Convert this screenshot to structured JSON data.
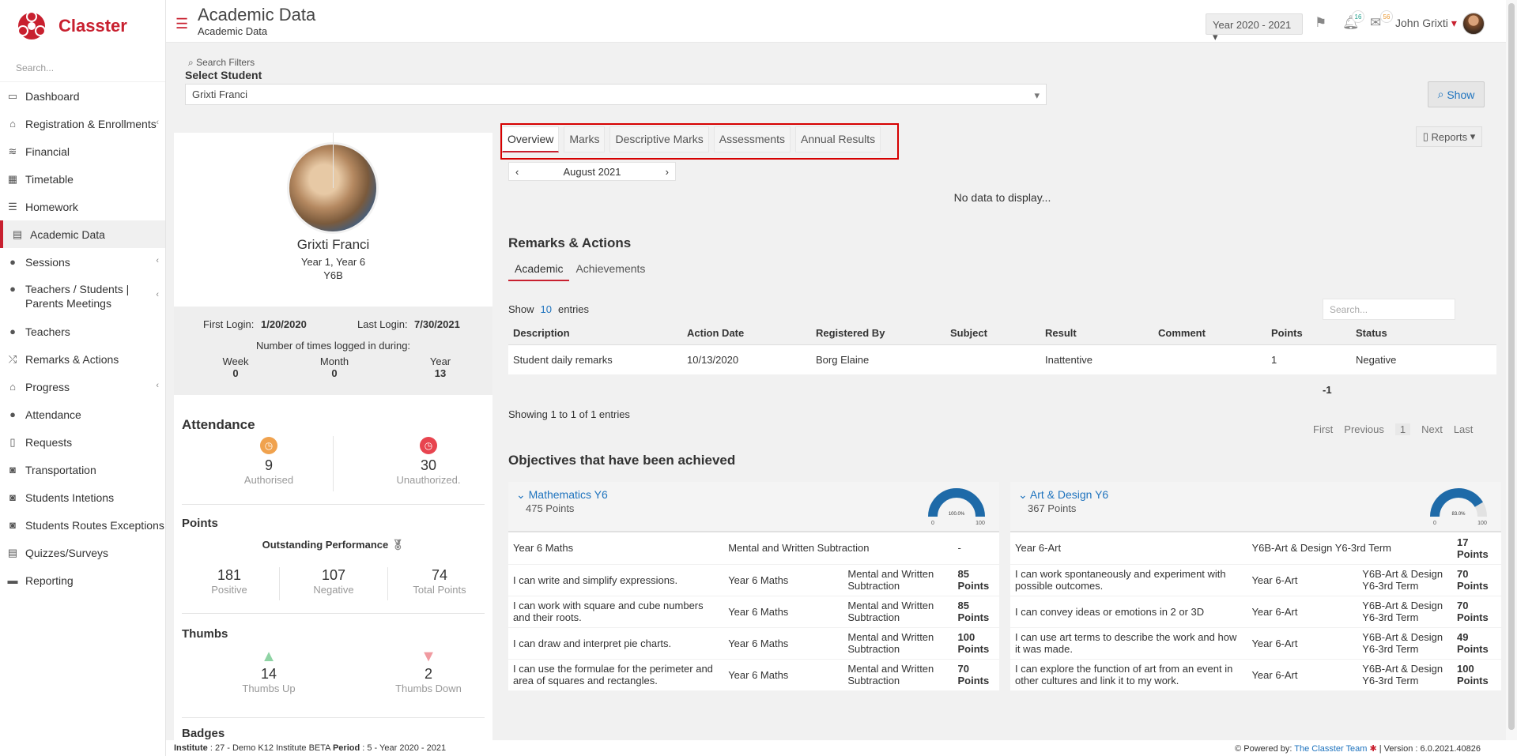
{
  "brand": {
    "name": "Classter"
  },
  "sidebar": {
    "search_placeholder": "Search...",
    "items": [
      {
        "label": "Dashboard",
        "icon": "laptop-icon"
      },
      {
        "label": "Registration & Enrollments",
        "icon": "bank-icon"
      },
      {
        "label": "Financial",
        "icon": "coins-icon"
      },
      {
        "label": "Timetable",
        "icon": "calendar-icon"
      },
      {
        "label": "Homework",
        "icon": "list-icon"
      },
      {
        "label": "Academic Data",
        "icon": "report-icon"
      },
      {
        "label": "Sessions",
        "icon": "users-icon"
      },
      {
        "label": "Teachers / Students | Parents Meetings",
        "icon": "meeting-icon"
      },
      {
        "label": "Teachers",
        "icon": "teachers-icon"
      },
      {
        "label": "Remarks & Actions",
        "icon": "remarks-icon"
      },
      {
        "label": "Progress",
        "icon": "graduation-cap-icon"
      },
      {
        "label": "Attendance",
        "icon": "user-x-icon"
      },
      {
        "label": "Requests",
        "icon": "document-icon"
      },
      {
        "label": "Transportation",
        "icon": "bus-icon"
      },
      {
        "label": "Students Intetions",
        "icon": "bus-icon"
      },
      {
        "label": "Students Routes Exceptions",
        "icon": "bus-icon"
      },
      {
        "label": "Quizzes/Surveys",
        "icon": "quiz-icon"
      },
      {
        "label": "Reporting",
        "icon": "printer-icon"
      }
    ]
  },
  "header": {
    "title": "Academic Data",
    "subtitle": "Academic Data",
    "year": "Year 2020 - 2021",
    "notifications": "16",
    "messages": "56",
    "user": "John Grixti"
  },
  "filters": {
    "label": "Search Filters",
    "select_student_label": "Select Student",
    "student": "Grixti Franci",
    "show_label": "Show"
  },
  "profile": {
    "name": "Grixti Franci",
    "year": "Year 1, Year 6",
    "class": "Y6B",
    "first_login_label": "First Login:",
    "first_login": "1/20/2020",
    "last_login_label": "Last Login:",
    "last_login": "7/30/2021",
    "times_label": "Number of times logged in during:",
    "week_label": "Week",
    "week": "0",
    "month_label": "Month",
    "month": "0",
    "year_label": "Year",
    "year_val": "13"
  },
  "attendance": {
    "title": "Attendance",
    "authorised": "9",
    "authorised_label": "Authorised",
    "unauthorized": "30",
    "unauthorized_label": "Unauthorized."
  },
  "points": {
    "title": "Points",
    "performance": "Outstanding Performance",
    "positive": "181",
    "positive_label": "Positive",
    "negative": "107",
    "negative_label": "Negative",
    "total": "74",
    "total_label": "Total Points"
  },
  "thumbs": {
    "title": "Thumbs",
    "up": "14",
    "up_label": "Thumbs Up",
    "down": "2",
    "down_label": "Thumbs Down"
  },
  "badges": {
    "title": "Badges"
  },
  "tabs": [
    "Overview",
    "Marks",
    "Descriptive Marks",
    "Assessments",
    "Annual Results"
  ],
  "reports_label": "Reports",
  "month": "August 2021",
  "no_data": "No data to display...",
  "remarks": {
    "title": "Remarks & Actions",
    "sub_tabs": [
      "Academic",
      "Achievements"
    ],
    "show": "Show",
    "entries_count": "10",
    "entries": "entries",
    "search_placeholder": "Search...",
    "columns": [
      "Description",
      "Action Date",
      "Registered By",
      "Subject",
      "Result",
      "Comment",
      "Points",
      "Status"
    ],
    "rows": [
      [
        "Student daily remarks",
        "10/13/2020",
        "Borg Elaine",
        "",
        "Inattentive",
        "",
        "1",
        "Negative"
      ]
    ],
    "total": "-1",
    "showing": "Showing 1 to 1 of 1 entries",
    "pager": [
      "First",
      "Previous",
      "1",
      "Next",
      "Last"
    ]
  },
  "objectives": {
    "title": "Objectives that have been achieved",
    "cards": [
      {
        "subject": "Mathematics Y6",
        "points": "475 Points",
        "gauge_pct": 100.0,
        "gauge_label": "100.0%",
        "gauge_min": "0",
        "gauge_max": "100",
        "rows": [
          [
            "Year 6 Maths",
            "Mental and Written Subtraction",
            "-",
            ""
          ],
          [
            "I can write and simplify expressions.",
            "Year 6 Maths",
            "Mental and Written Subtraction",
            "85 Points"
          ],
          [
            "I can work with square and cube numbers and their roots.",
            "Year 6 Maths",
            "Mental and Written Subtraction",
            "85 Points"
          ],
          [
            "I can draw and interpret pie charts.",
            "Year 6 Maths",
            "Mental and Written Subtraction",
            "100 Points"
          ],
          [
            "I can use the formulae for the perimeter and area of squares and rectangles.",
            "Year 6 Maths",
            "Mental and Written Subtraction",
            "70 Points"
          ]
        ]
      },
      {
        "subject": "Art & Design Y6",
        "points": "367 Points",
        "gauge_pct": 83.0,
        "gauge_label": "83.0%",
        "gauge_min": "0",
        "gauge_max": "100",
        "rows": [
          [
            "Year 6-Art",
            "Y6B-Art & Design Y6-3rd Term",
            "17 Points",
            ""
          ],
          [
            "I can work spontaneously and experiment with possible outcomes.",
            "Year 6-Art",
            "Y6B-Art & Design Y6-3rd Term",
            "70 Points"
          ],
          [
            "I can convey ideas or emotions in 2 or 3D",
            "Year 6-Art",
            "Y6B-Art & Design Y6-3rd Term",
            "70 Points"
          ],
          [
            "I can use art terms to describe the work and how it was made.",
            "Year 6-Art",
            "Y6B-Art & Design Y6-3rd Term",
            "49 Points"
          ],
          [
            "I can explore the function of art from an event in other cultures and link it to my work.",
            "Year 6-Art",
            "Y6B-Art & Design Y6-3rd Term",
            "100 Points"
          ]
        ]
      }
    ]
  },
  "footer": {
    "institute_label": "Institute",
    "institute": ": 27 - Demo K12 Institute BETA",
    "period_label": "Period",
    "period": ": 5 - Year 2020 - 2021",
    "powered": "Powered by:",
    "team": "The Classter Team",
    "version": "| Version : 6.0.2021.40826"
  },
  "colors": {
    "brand": "#c8202f",
    "link": "#1e73be",
    "gauge": "#1e6aa8"
  }
}
